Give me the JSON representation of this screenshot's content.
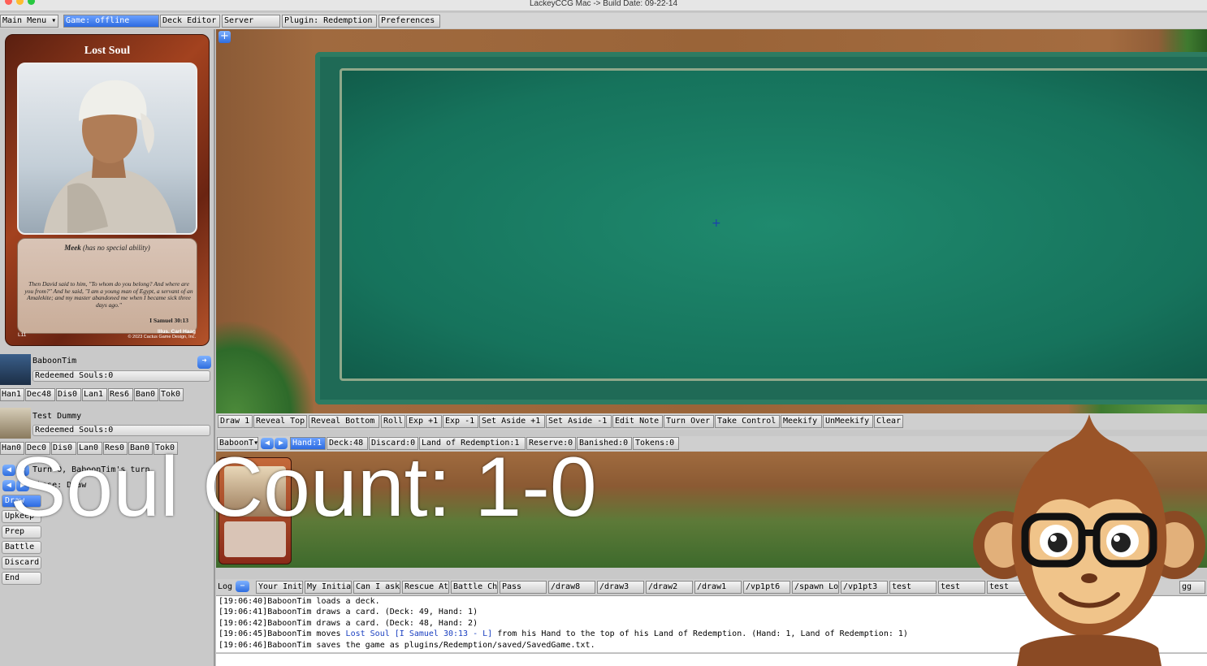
{
  "window": {
    "title": "LackeyCCG Mac -> Build Date: 09-22-14"
  },
  "menubar": {
    "main_menu": "Main Menu",
    "game": "Game: offline",
    "deck_editor": "Deck Editor",
    "server": "Server",
    "plugin": "Plugin: Redemption",
    "preferences": "Preferences"
  },
  "card_preview": {
    "title": "Lost Soul",
    "ability": "Meek",
    "ability_note": "(has no special ability)",
    "verse": "Then David said to him, \"To whom do you belong? And where are you from?\" And he said, \"I am a young man of Egypt, a servant of an Amalekite; and my master abandoned me when I became sick three days ago.\"",
    "reference": "I Samuel 30:13",
    "code": "L11",
    "illustrator": "Illus. Carl Haag",
    "copyright": "© 2023 Cactus Game Design, Inc."
  },
  "players": [
    {
      "name": "BaboonTim",
      "souls": "Redeemed Souls:0",
      "zones": [
        "Han1",
        "Dec48",
        "Dis0",
        "Lan1",
        "Res6",
        "Ban0",
        "Tok0"
      ]
    },
    {
      "name": "Test Dummy",
      "souls": "Redeemed Souls:0",
      "zones": [
        "Han0",
        "Dec0",
        "Dis0",
        "Lan0",
        "Res0",
        "Ban0",
        "Tok0"
      ]
    }
  ],
  "turn": {
    "line1": "Turn 0, BaboonTim's turn",
    "line2": "Phase: Draw"
  },
  "phases": [
    "Draw",
    "Upkeep",
    "Prep",
    "Battle",
    "Discard",
    "End"
  ],
  "actions": [
    "Draw 1",
    "Reveal Top",
    "Reveal Bottom",
    "Roll",
    "Exp +1",
    "Exp -1",
    "Set Aside +1",
    "Set Aside -1",
    "Edit Note",
    "Turn Over",
    "Take Control",
    "Meekify",
    "UnMeekify",
    "Clear"
  ],
  "zonebar": {
    "player": "BaboonT",
    "zones": [
      "Hand:1",
      "Deck:48",
      "Discard:0",
      "Land of Redemption:1",
      "Reserve:0",
      "Banished:0",
      "Tokens:0"
    ]
  },
  "log": {
    "label": "Log",
    "macros": [
      "Your Init",
      "My Initia",
      "Can I ask",
      "Rescue At",
      "Battle Ch",
      "Pass",
      "/draw8",
      "/draw3",
      "/draw2",
      "/draw1",
      "/vp1pt6",
      "/spawn Lo",
      "/vp1pt3",
      "test",
      "test",
      "test",
      "gg"
    ],
    "lines": [
      {
        "time": "[19:06:40]",
        "text": "BaboonTim loads a deck."
      },
      {
        "time": "[19:06:41]",
        "text": "BaboonTim draws a card. (Deck: 49, Hand: 1)"
      },
      {
        "time": "[19:06:42]",
        "text": "BaboonTim draws a card. (Deck: 48, Hand: 2)"
      },
      {
        "time": "[19:06:45]",
        "pre": "BaboonTim moves ",
        "link": "Lost Soul [I Samuel 30:13 - L]",
        "post": " from his Hand to the top of his Land of Redemption. (Hand: 1, Land of Redemption: 1)"
      },
      {
        "time": "[19:06:46]",
        "text": "BaboonTim saves the game as plugins/Redemption/saved/SavedGame.txt."
      }
    ]
  },
  "overlay": {
    "soul_count": "Soul Count: 1-0"
  },
  "colors": {
    "accent": "#2d6be0",
    "mat": "#16735c",
    "log_link": "#1a3fc0"
  }
}
